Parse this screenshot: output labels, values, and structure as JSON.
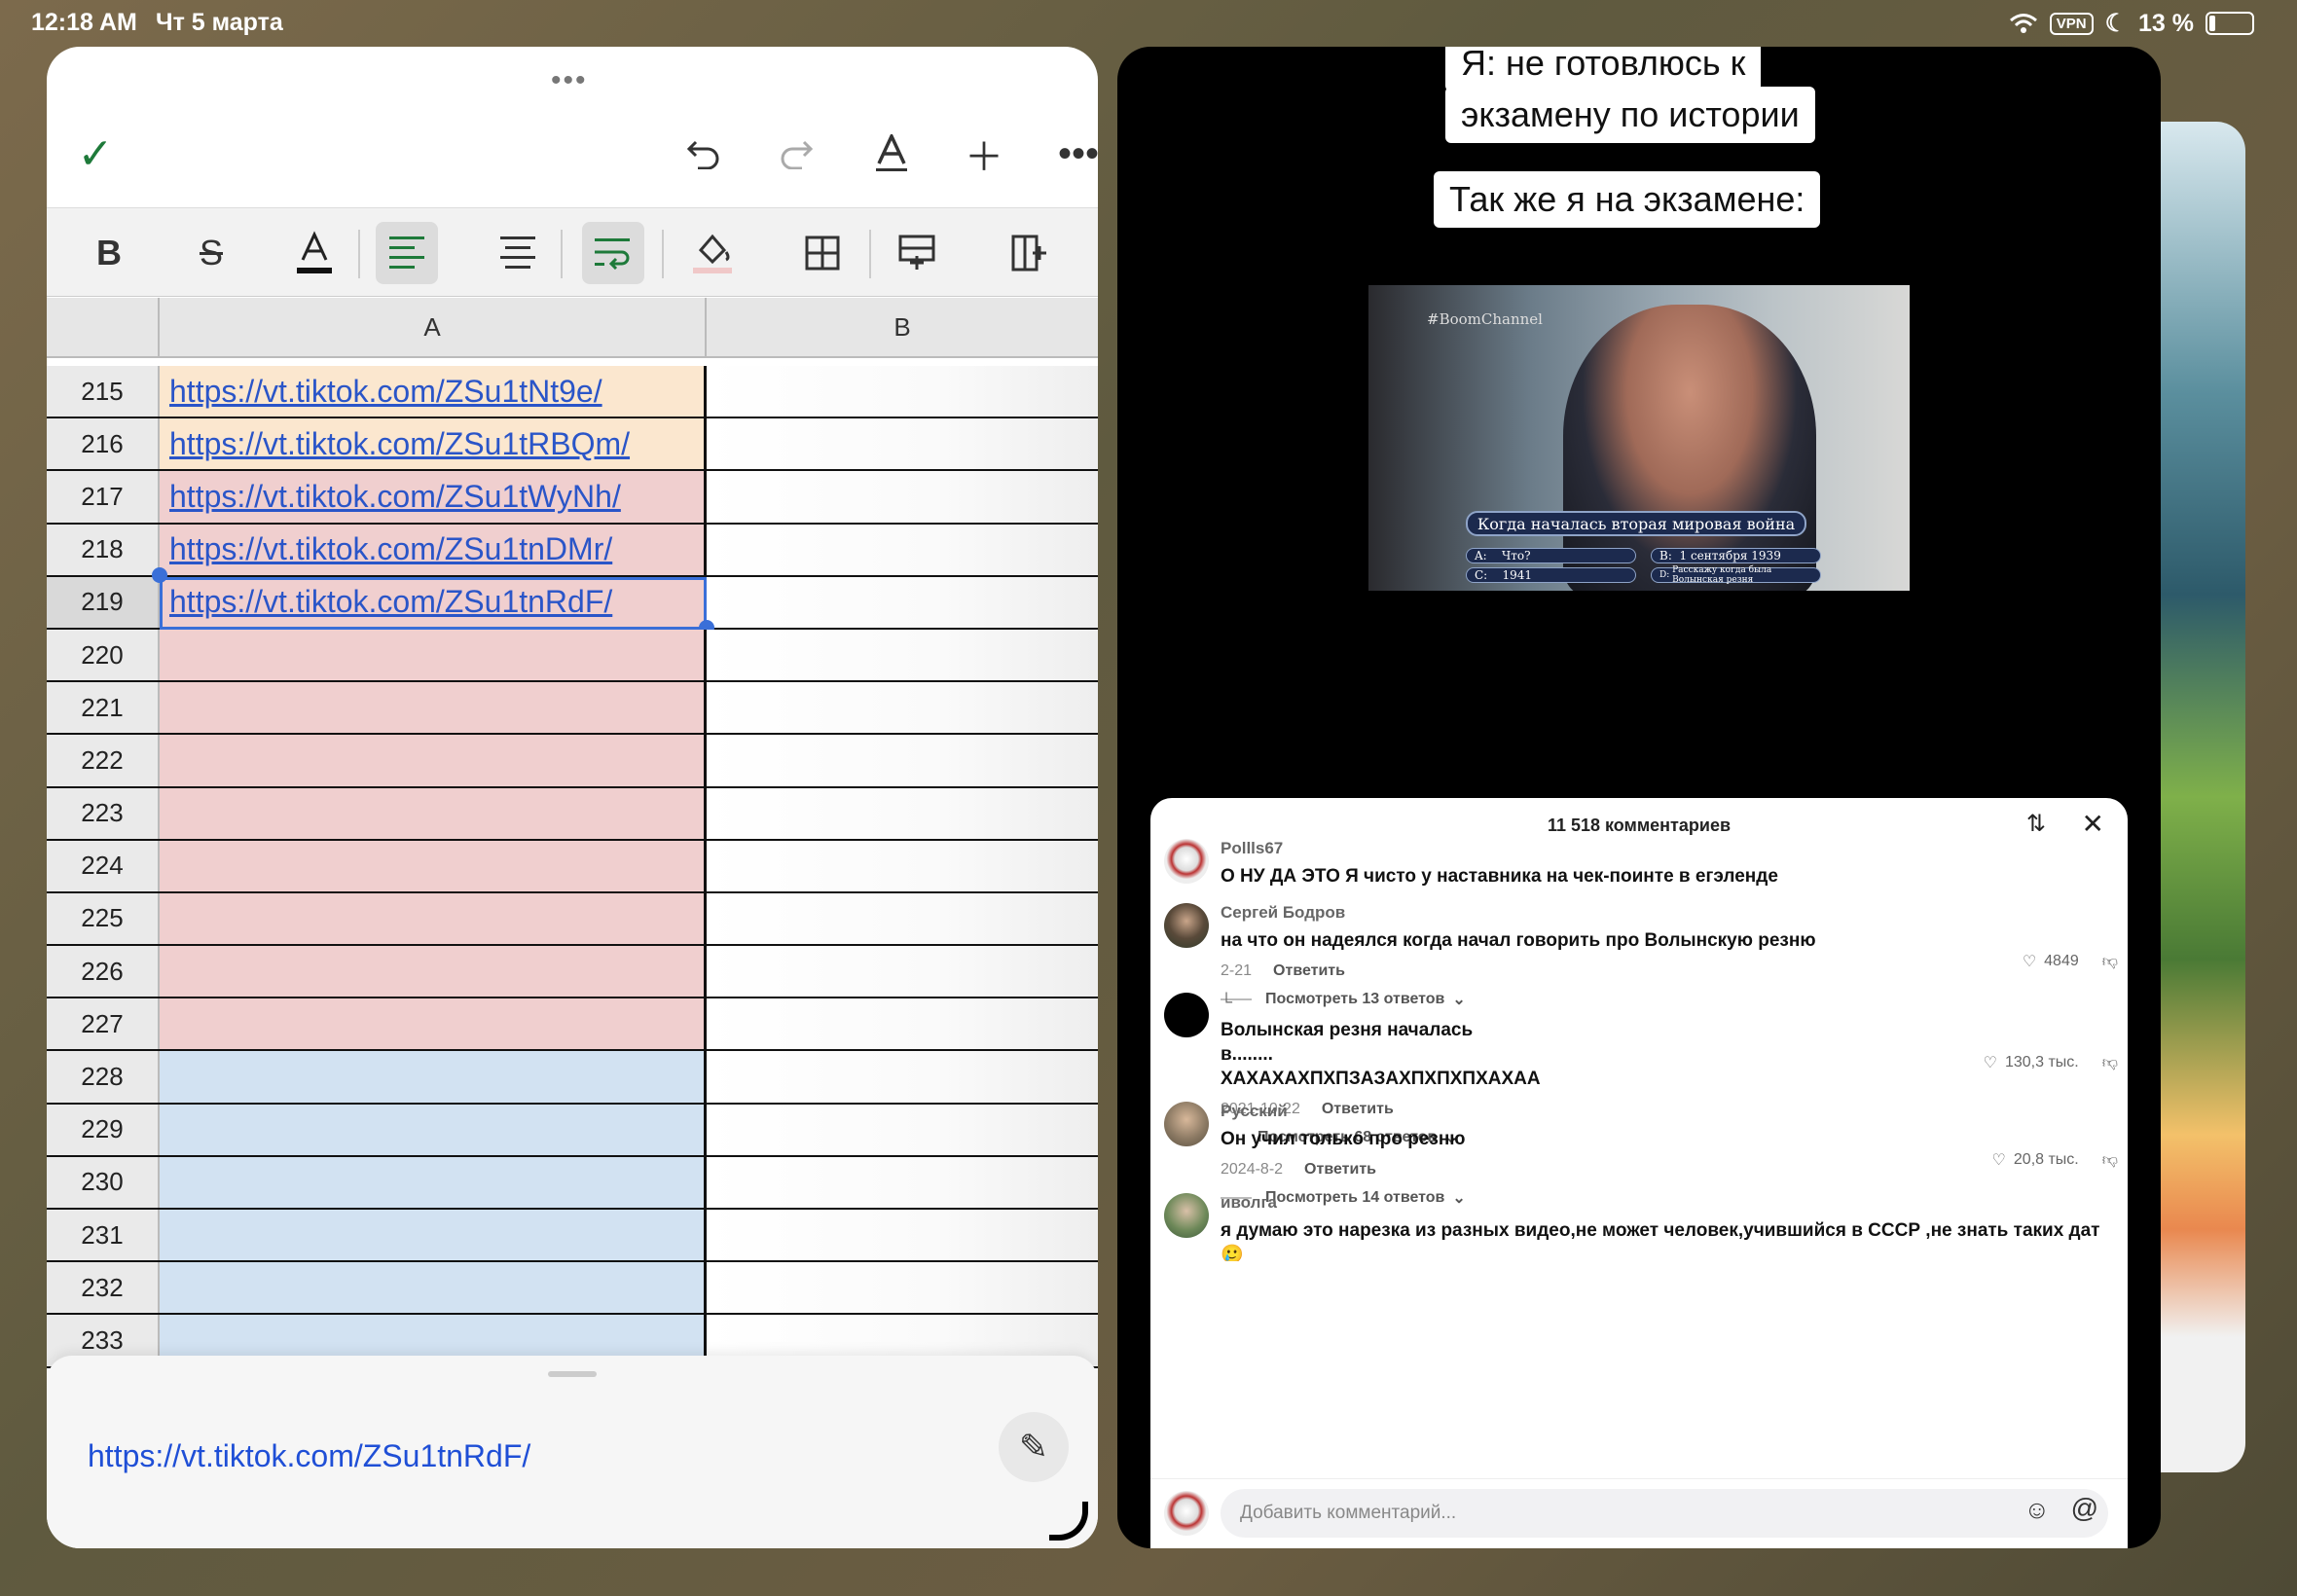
{
  "status_bar": {
    "time": "12:18 AM",
    "date": "Чт 5 марта",
    "vpn": "VPN",
    "battery": "13 %"
  },
  "sheet": {
    "more_dots": "•••",
    "columns": [
      "A",
      "B"
    ],
    "rows": [
      {
        "n": "215",
        "a": "https://vt.tiktok.com/ZSu1tNt9e/",
        "color": "orange"
      },
      {
        "n": "216",
        "a": "https://vt.tiktok.com/ZSu1tRBQm/",
        "color": "orange"
      },
      {
        "n": "217",
        "a": "https://vt.tiktok.com/ZSu1tWyNh/",
        "color": "pink"
      },
      {
        "n": "218",
        "a": "https://vt.tiktok.com/ZSu1tnDMr/",
        "color": "pink"
      },
      {
        "n": "219",
        "a": "https://vt.tiktok.com/ZSu1tnRdF/",
        "color": "pink"
      },
      {
        "n": "220",
        "a": "",
        "color": "pink"
      },
      {
        "n": "221",
        "a": "",
        "color": "pink"
      },
      {
        "n": "222",
        "a": "",
        "color": "pink"
      },
      {
        "n": "223",
        "a": "",
        "color": "pink"
      },
      {
        "n": "224",
        "a": "",
        "color": "pink"
      },
      {
        "n": "225",
        "a": "",
        "color": "pink"
      },
      {
        "n": "226",
        "a": "",
        "color": "pink"
      },
      {
        "n": "227",
        "a": "",
        "color": "pink"
      },
      {
        "n": "228",
        "a": "",
        "color": "blue"
      },
      {
        "n": "229",
        "a": "",
        "color": "blue"
      },
      {
        "n": "230",
        "a": "",
        "color": "blue"
      },
      {
        "n": "231",
        "a": "",
        "color": "blue"
      },
      {
        "n": "232",
        "a": "",
        "color": "blue"
      },
      {
        "n": "233",
        "a": "",
        "color": "blue"
      }
    ],
    "selected_row": "219",
    "formula_value": "https://vt.tiktok.com/ZSu1tnRdF/",
    "colors": {
      "orange": "#fbe7cf",
      "pink": "#f0cfcf",
      "blue": "#d2e2f2",
      "accent": "#1e7a3a",
      "link": "#2a55c8"
    }
  },
  "video": {
    "caption_1": "Я: не готовлюсь к",
    "caption_2": "экзамену по истории",
    "caption_3": "Так же я на экзамене:",
    "watermark": "#BoomChannel",
    "question": "Когда началась вторая мировая война",
    "answers": {
      "a_label": "A:",
      "a": "Что?",
      "b_label": "B:",
      "b": "1 сентября 1939",
      "c_label": "C:",
      "c": "1941",
      "d_label": "D:",
      "d": "Расскажу когда была Волынская резня"
    }
  },
  "comments": {
    "title": "11 518 комментариев",
    "items": [
      {
        "user": "Pollls67",
        "text": "О НУ ДА ЭТО Я чисто у наставника на чек-поинте в егэленде",
        "date": "",
        "reply": "",
        "likes": "",
        "replies": ""
      },
      {
        "user": "Сергей Бодров",
        "text": "на что он надеялся когда начал говорить про Волынскую резню",
        "date": "2-21",
        "reply": "Ответить",
        "likes": "4849",
        "replies": "Посмотреть 13 ответов"
      },
      {
        "user": "└",
        "text": "Волынская резня началась в........ ХАХАХАХПХПЗАЗАХПХПХПХАХАА",
        "date": "2021-10-22",
        "reply": "Ответить",
        "likes": "130,3 тыс.",
        "replies": "Посмотреть 68 ответов"
      },
      {
        "user": "Русский",
        "text": "Он учил только про резню",
        "date": "2024-8-2",
        "reply": "Ответить",
        "likes": "20,8 тыс.",
        "replies": "Посмотреть 14 ответов"
      },
      {
        "user": "иволга",
        "text": "я думаю это нарезка из разных видео,не может человек,учившийся в СССР ,не знать таких дат🥲",
        "date": "",
        "reply": "",
        "likes": "",
        "replies": ""
      }
    ],
    "add_placeholder": "Добавить комментарий..."
  }
}
